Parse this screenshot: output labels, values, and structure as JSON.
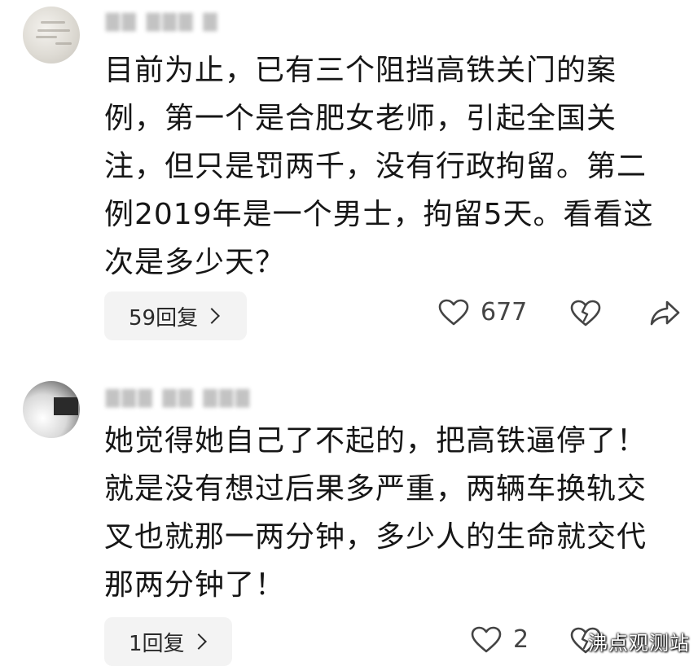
{
  "comments": [
    {
      "text": "目前为止，已有三个阻挡高铁关门的案例，第一个是合肥女老师，引起全国关注，但只是罚两千，没有行政拘留。第二例2019年是一个男士，拘留5天。看看这次是多少天？",
      "replies_label": "59回复",
      "like_count": "677"
    },
    {
      "text": "她觉得她自己了不起的，把高铁逼停了！就是没有想过后果多严重，两辆车换轨交叉也就那一两分钟，多少人的生命就交代那两分钟了！",
      "replies_label": "1回复",
      "like_count": "2"
    }
  ],
  "watermark": "沸点观测站",
  "icons": {
    "like": "heart-outline-icon",
    "dislike": "broken-heart-icon",
    "share": "share-arrow-icon",
    "reply_chevron": "chevron-right-icon"
  }
}
